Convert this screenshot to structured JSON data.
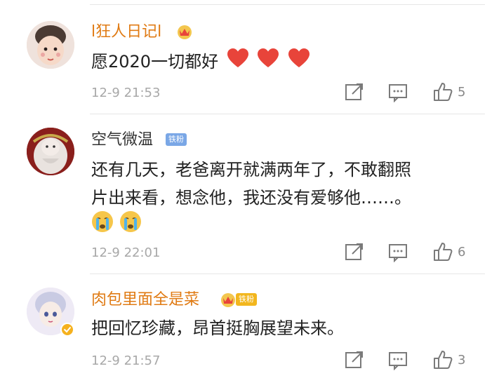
{
  "colors": {
    "orange_name": "#e07b14",
    "normal_name": "#333333",
    "heart": "#e8443a",
    "fan_blue": "#7aa7e6",
    "fan_gold": "#f2b61d"
  },
  "comments": [
    {
      "username": "l狂人日记l",
      "text": "愿2020一切都好",
      "reaction_icons": [
        "heart-icon",
        "heart-icon",
        "heart-icon"
      ],
      "timestamp": "12-9 21:53",
      "likes": "5"
    },
    {
      "username": "空气微温",
      "badge": "铁粉",
      "text_lines": [
        "还有几天，老爸离开就满两年了，不敢翻照",
        "片出来看，想念他，我还没有爱够他……。"
      ],
      "reaction_icons": [
        "crying-face-icon",
        "crying-face-icon"
      ],
      "timestamp": "12-9 22:01",
      "likes": "6"
    },
    {
      "username": "肉包里面全是菜",
      "badge": "铁粉",
      "text": "把回忆珍藏，昂首挺胸展望未来。",
      "timestamp": "12-9 21:57",
      "likes": "3"
    }
  ]
}
